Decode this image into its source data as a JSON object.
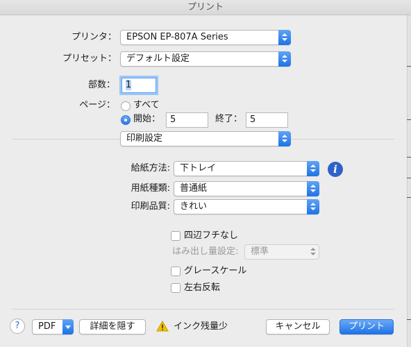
{
  "window": {
    "title": "プリント"
  },
  "printer": {
    "label": "プリンタ：",
    "value": "EPSON EP-807A Series"
  },
  "preset": {
    "label": "プリセット：",
    "value": "デフォルト設定"
  },
  "copies": {
    "label": "部数：",
    "value": "1"
  },
  "pages": {
    "label": "ページ：",
    "all_label": "すべて",
    "range_label": "開始：",
    "from": "5",
    "to_label": "終了：",
    "to": "5"
  },
  "section": {
    "value": "印刷設定"
  },
  "settings": {
    "paper_source": {
      "label": "給紙方法:",
      "value": "下トレイ"
    },
    "media_type": {
      "label": "用紙種類:",
      "value": "普通紙"
    },
    "print_quality": {
      "label": "印刷品質:",
      "value": "きれい"
    },
    "borderless": {
      "label": "四辺フチなし"
    },
    "expansion": {
      "label": "はみ出し量設定:",
      "value": "標準"
    },
    "grayscale": {
      "label": "グレースケール"
    },
    "mirror": {
      "label": "左右反転"
    }
  },
  "footer": {
    "help": "?",
    "pdf": "PDF",
    "hide_details": "詳細を隠す",
    "status": "インク残量少",
    "cancel": "キャンセル",
    "print": "プリント"
  },
  "icons": {
    "help": "question-mark",
    "info": "info-i",
    "warning": "warning-triangle"
  },
  "colors": {
    "accent": "#1f73e6",
    "info": "#2f62c8",
    "warning": "#f2c200"
  }
}
